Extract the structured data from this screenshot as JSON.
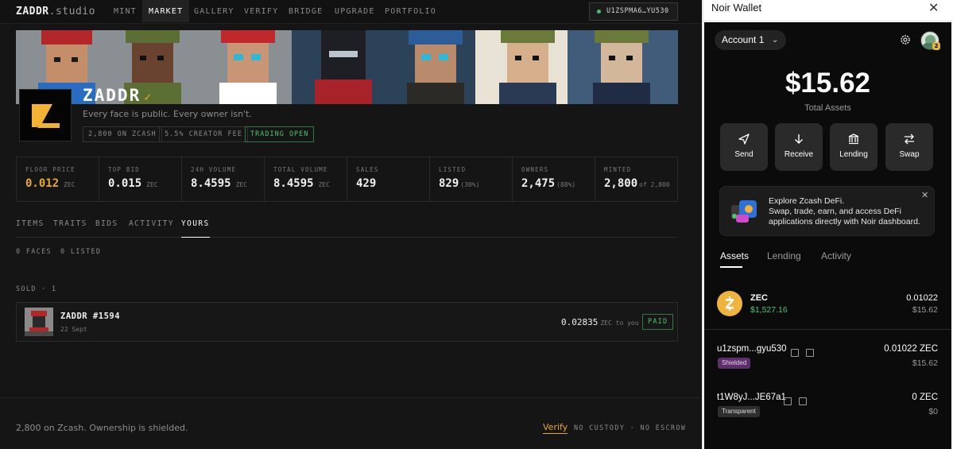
{
  "nav": {
    "logo_brand": "ZADDR",
    "logo_suffix": ".studio",
    "items": [
      "MINT",
      "MARKET",
      "GALLERY",
      "VERIFY",
      "BRIDGE",
      "UPGRADE",
      "PORTFOLIO"
    ],
    "active": "MARKET",
    "address": "U1ZSPMA6…YU530",
    "address_status_color": "#49c06b"
  },
  "collection": {
    "name": "ZADDR",
    "verified_icon": "check-icon",
    "tagline": "Every face is public. Every owner isn't.",
    "chips": [
      "2,800 ON ZCASH",
      "5.5% CREATOR FEE",
      "TRADING OPEN"
    ]
  },
  "stats": [
    {
      "label": "FLOOR PRICE",
      "value": "0.012",
      "unit": "ZEC",
      "sub": ""
    },
    {
      "label": "TOP BID",
      "value": "0.015",
      "unit": "ZEC",
      "sub": ""
    },
    {
      "label": "24H VOLUME",
      "value": "8.4595",
      "unit": "ZEC",
      "sub": ""
    },
    {
      "label": "TOTAL VOLUME",
      "value": "8.4595",
      "unit": "ZEC",
      "sub": ""
    },
    {
      "label": "SALES",
      "value": "429",
      "unit": "",
      "sub": ""
    },
    {
      "label": "LISTED",
      "value": "829",
      "unit": "",
      "sub": "(30%)"
    },
    {
      "label": "OWNERS",
      "value": "2,475",
      "unit": "",
      "sub": "(88%)"
    },
    {
      "label": "MINTED",
      "value": "2,800",
      "unit": "",
      "sub": "of 2,800"
    }
  ],
  "tabs": [
    "ITEMS",
    "TRAITS",
    "BIDS",
    "ACTIVITY",
    "YOURS"
  ],
  "active_tab": "YOURS",
  "yours": {
    "faces": "0 FACES",
    "listed": "0 LISTED",
    "sold_label": "SOLD · 1",
    "sold_item": {
      "name": "ZADDR #1594",
      "date": "22 Sept",
      "price": "0.02835",
      "price_unit": "ZEC to you",
      "status": "PAID"
    }
  },
  "footer": {
    "left": "2,800 on Zcash. Ownership is shielded.",
    "verify": "Verify",
    "right": "NO CUSTODY · NO ESCROW"
  },
  "wallet": {
    "title": "Noir Wallet",
    "account": "Account 1",
    "avatar_badge": "2",
    "balance": "$15.62",
    "balance_label": "Total Assets",
    "actions": [
      {
        "label": "Send",
        "icon": "send-icon"
      },
      {
        "label": "Receive",
        "icon": "receive-icon"
      },
      {
        "label": "Lending",
        "icon": "bank-icon"
      },
      {
        "label": "Swap",
        "icon": "swap-icon"
      }
    ],
    "promo": {
      "line1": "Explore Zcash DeFi.",
      "line2": "Swap, trade, earn, and access DeFi applications directly with Noir dashboard."
    },
    "tabs": [
      "Assets",
      "Lending",
      "Activity"
    ],
    "active_tab": "Assets",
    "asset": {
      "symbol": "ZEC",
      "price": "$1,527.16",
      "amount": "0.01022",
      "usd": "$15.62"
    },
    "addresses": [
      {
        "addr": "u1zspm...gyu530",
        "badge": "Shielded",
        "amount": "0.01022 ZEC",
        "usd": "$15.62"
      },
      {
        "addr": "t1W8yJ...JE67a1",
        "badge": "Transparent",
        "amount": "0 ZEC",
        "usd": "$0"
      }
    ],
    "accent_color": "#4fc56f",
    "zec_color": "#f0b33c"
  }
}
